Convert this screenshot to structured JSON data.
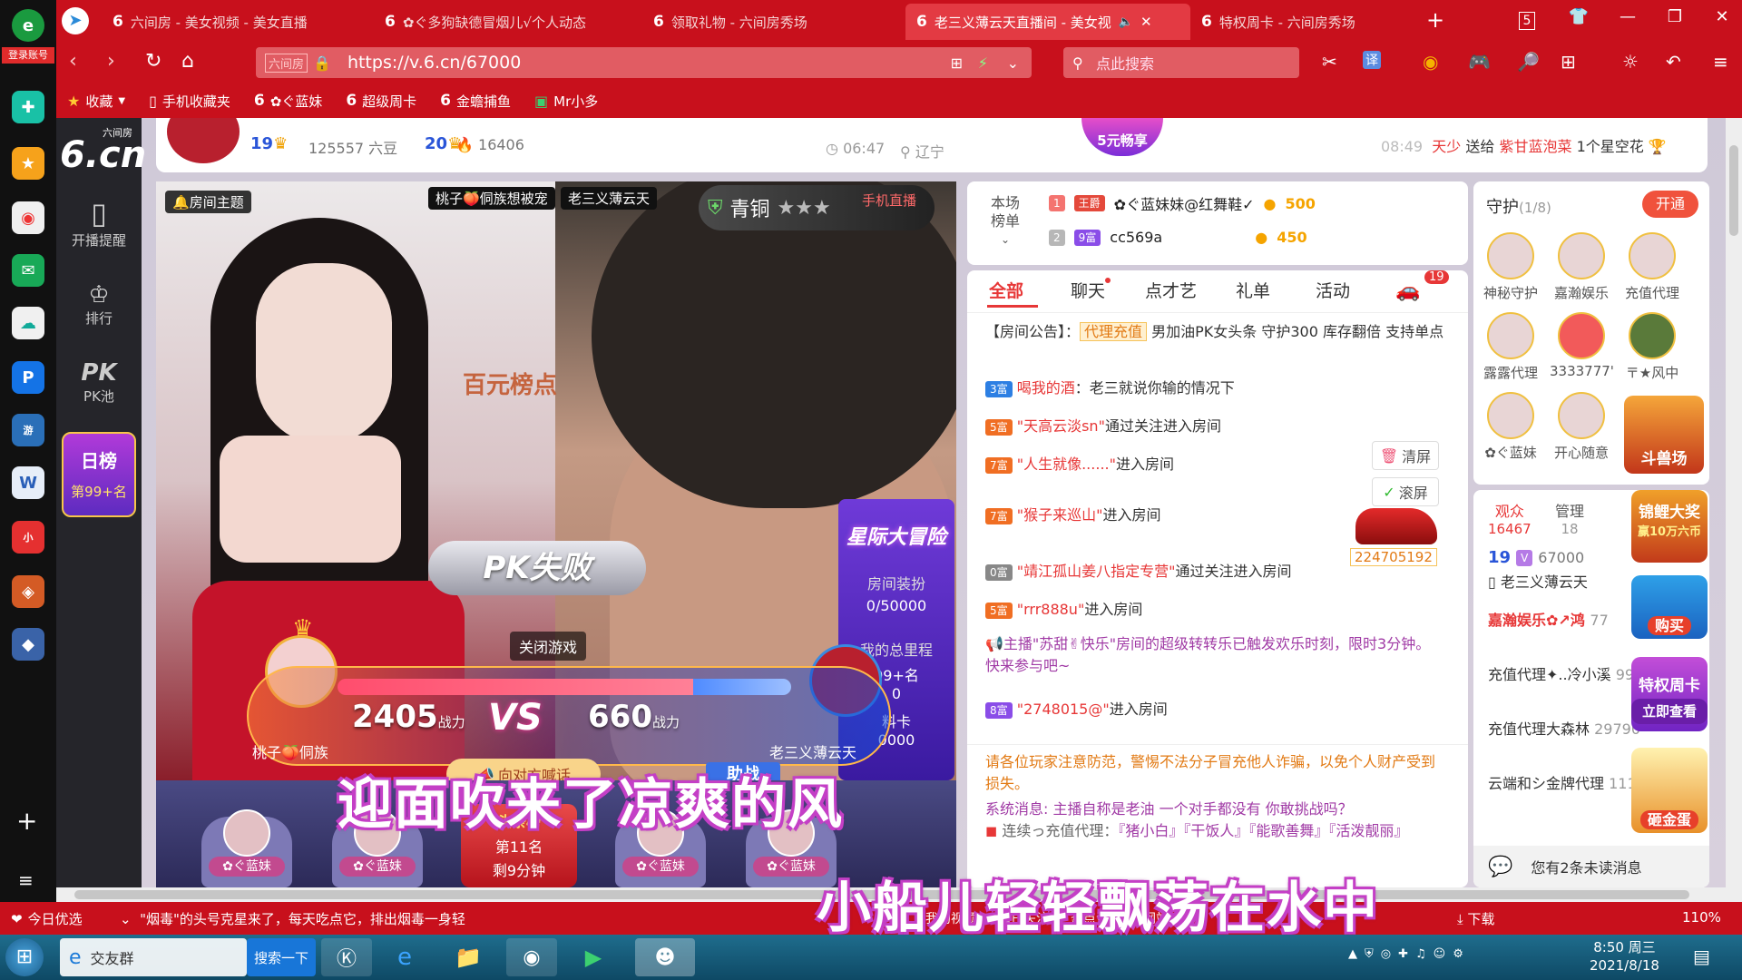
{
  "browser": {
    "account_label": "登录账号",
    "tabs": [
      {
        "label": "六间房 - 美女视频 - 美女直播"
      },
      {
        "label": "✿ぐ多狗缺德冒烟儿√个人动态"
      },
      {
        "label": "领取礼物 - 六间房秀场"
      },
      {
        "label": "老三义薄云天直播间 - 美女视"
      },
      {
        "label": "特权周卡 - 六间房秀场"
      }
    ],
    "tab_count": "5",
    "url": "https://v.6.cn/67000",
    "url_prefix": "六间房",
    "search_placeholder": "点此搜索",
    "translate_label": "译",
    "bookmarks": [
      {
        "label": "收藏"
      },
      {
        "label": "手机收藏夹"
      },
      {
        "label": "✿ぐ蓝妹"
      },
      {
        "label": "超级周卡"
      },
      {
        "label": "金蟾捕鱼"
      },
      {
        "label": "Mr小多"
      }
    ]
  },
  "site": {
    "logo_top": "六间房",
    "logo_main": "6.cn",
    "sidebar": [
      {
        "label": "开播提醒"
      },
      {
        "label": "排行"
      },
      {
        "label": "PK池"
      }
    ],
    "daily_rank_title": "日榜",
    "daily_rank_value": "第99+名"
  },
  "header": {
    "level": "19",
    "beans": "125557 六豆",
    "level2": "20",
    "heat": "16406",
    "time": "06:47",
    "location": "辽宁",
    "promo": "5元畅享",
    "gift_time": "08:49",
    "gift_text_user": "天少",
    "gift_text_action": "送给",
    "gift_text_target": "紫甘蓝泡菜",
    "gift_text_item": "1个星空花"
  },
  "video": {
    "room_topic": "房间主题",
    "left_name_tag": "桃子🍑侗族想被宠",
    "right_name_tag": "老三义薄云天",
    "bronze_label": "青铜",
    "watermark": "手机直播",
    "hundred_rank": "百元榜点",
    "pk_fail": "PK失败",
    "close_game": "关闭游戏",
    "left_score": "2405",
    "right_score": "660",
    "score_unit": "战力",
    "vs": "VS",
    "left_streamer": "桃子🍑侗族",
    "right_streamer": "老三义薄云天",
    "shout_btn": "向对方喊话",
    "assist_btn": "助战",
    "adventure_title": "星际大冒险",
    "room_decor_label": "房间装扮",
    "room_decor_value": "0/50000",
    "my_mileage_label": "我的总里程",
    "my_mileage_value": "99+名",
    "my_mileage_zero": "0",
    "material_card": "料卡",
    "material_value": "0000",
    "headline_title": "头条榜",
    "headline_rank": "第11名",
    "headline_time": "剩9分钟",
    "seats": [
      {
        "name": "✿ぐ蓝妹"
      },
      {
        "name": "✿ぐ蓝妹"
      },
      {
        "name": "✿ぐ蓝妹"
      },
      {
        "name": "✿ぐ蓝妹"
      }
    ],
    "subtitle_1": "迎面吹来了凉爽的风",
    "subtitle_2": "小船儿轻轻飘荡在水中"
  },
  "ranking": {
    "title_1": "本场",
    "title_2": "榜单",
    "rows": [
      {
        "rank": "1",
        "badge": "王爵",
        "name": "✿ぐ蓝妹妹@红舞鞋✓",
        "score": "500"
      },
      {
        "rank": "2",
        "badge": "9富",
        "name": "cc569a",
        "score": "450"
      }
    ]
  },
  "chat": {
    "tabs": [
      {
        "label": "全部"
      },
      {
        "label": "聊天"
      },
      {
        "label": "点才艺"
      },
      {
        "label": "礼单"
      },
      {
        "label": "活动"
      }
    ],
    "car_badge": "19",
    "notice_prefix": "【房间公告】：",
    "notice_tag": "代理充值",
    "notice_text": "男加油PK女头条 守护300 库存翻倍 支持单点",
    "messages": [
      {
        "badge": "3富",
        "name": "喝我的酒",
        "text": "：老三就说你输的情况下"
      },
      {
        "badge": "5富",
        "name": "\"天高云淡sn\"",
        "text": "通过关注进入房间"
      },
      {
        "badge": "7富",
        "name": "\"人生就像......\"",
        "text": "进入房间"
      },
      {
        "badge": "7富",
        "name": "\"猴子来巡山\"",
        "text": "进入房间"
      },
      {
        "badge": "0富",
        "name": "\"靖江孤山姜八指定专营\"",
        "text": "通过关注进入房间"
      },
      {
        "badge": "5富",
        "name": "\"rrr888u\"",
        "text": "进入房间"
      },
      {
        "badge": "8富",
        "name": "\"2748015@\"",
        "text": "进入房间"
      }
    ],
    "system_notice": "主播\"苏甜✌快乐\"房间的超级转转乐已触发欢乐时刻，限时3分钟。快来参与吧~",
    "clear_btn": "清屏",
    "scroll_btn": "滚屏",
    "car_id": "224705192",
    "warning": "请各位玩家注意防范，警惕不法分子冒充他人诈骗，以免个人财产受到损失。",
    "system_msg": "系统消息: 主播自称是老油 一个对手都没有 你敢挑战吗？",
    "agents_prefix": "连续っ充值代理：",
    "agents": "『猪小白』『干饭人』『能歌善舞』『活泼靓丽』"
  },
  "guard": {
    "title": "守护",
    "count": "(1/8)",
    "open_btn": "开通",
    "members": [
      {
        "name": "神秘守护"
      },
      {
        "name": "嘉瀚娱乐"
      },
      {
        "name": "充值代理"
      },
      {
        "name": "露露代理"
      },
      {
        "name": "3333777'"
      },
      {
        "name": "〒★风中"
      },
      {
        "name": "✿ぐ蓝妹"
      },
      {
        "name": "开心随意"
      }
    ],
    "beast_arena": "斗兽场"
  },
  "audience": {
    "tab_audience": "观众",
    "audience_count": "16467",
    "tab_manage": "管理",
    "manage_count": "18",
    "host_level": "19",
    "host_id": "67000",
    "host_name": "老三义薄云天",
    "rows": [
      {
        "name": "嘉瀚娱乐✿↗鸿",
        "num": "77"
      },
      {
        "name": "充值代理✦..冷小溪",
        "num": "998"
      },
      {
        "name": "充值代理大森林",
        "num": "29790"
      },
      {
        "name": "云端和シ金牌代理",
        "num": "11115"
      }
    ],
    "unread": "您有2条未读消息"
  },
  "promos": {
    "koi": "锦鲤大奖",
    "koi_sub": "赢10万六币",
    "buy": "购买",
    "privilege": "特权周卡",
    "privilege_btn": "立即查看",
    "egg": "砸金蛋"
  },
  "statusbar": {
    "today": "今日优选",
    "news": "\"烟毒\"的头号克星来了，每天吃点它，排出烟毒一身轻",
    "links": [
      {
        "label": "我的视频"
      },
      {
        "label": "每日关注"
      },
      {
        "label": "热点资讯"
      },
      {
        "label": "网站信用"
      }
    ],
    "download": "下载",
    "zoom": "110%"
  },
  "taskbar": {
    "ie_label": "交友群",
    "search_btn": "搜索一下",
    "time": "8:50 周三",
    "date": "2021/8/18"
  }
}
